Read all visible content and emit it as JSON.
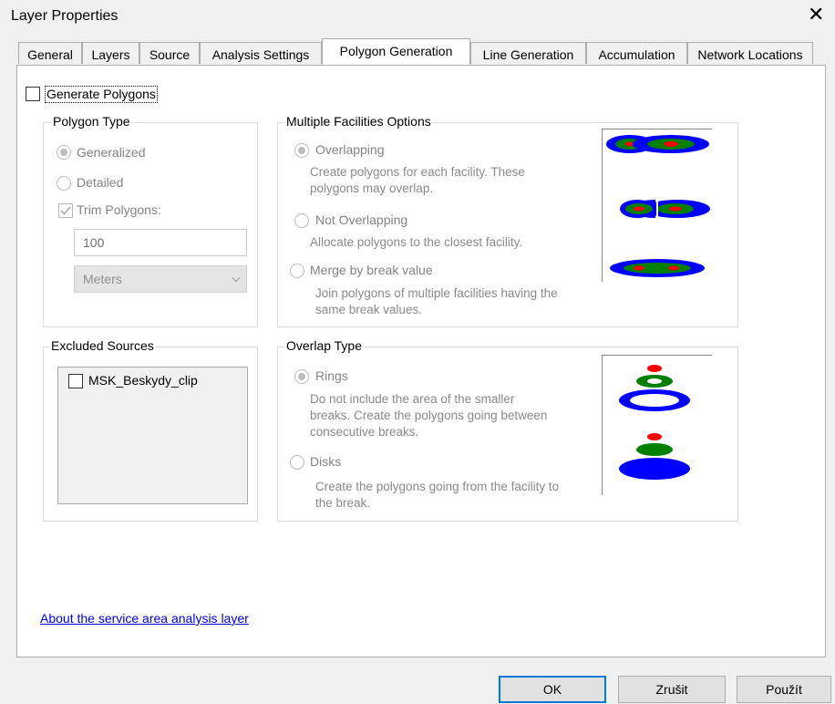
{
  "window": {
    "title": "Layer Properties",
    "close_glyph": "✕"
  },
  "tabs": [
    {
      "label": "General"
    },
    {
      "label": "Layers"
    },
    {
      "label": "Source"
    },
    {
      "label": "Analysis Settings"
    },
    {
      "label": "Polygon Generation",
      "active": true
    },
    {
      "label": "Line Generation"
    },
    {
      "label": "Accumulation"
    },
    {
      "label": "Network Locations"
    }
  ],
  "generate_polygons": {
    "label": "Generate Polygons",
    "checked": false
  },
  "polygon_type": {
    "title": "Polygon Type",
    "generalized": "Generalized",
    "detailed": "Detailed",
    "trim_polygons": "Trim Polygons:",
    "trim_value": "100",
    "units_selected": "Meters"
  },
  "multiple_facilities": {
    "title": "Multiple Facilities Options",
    "overlapping": "Overlapping",
    "overlapping_desc": [
      "Create polygons for each facility. These",
      "polygons may overlap."
    ],
    "not_overlapping": "Not Overlapping",
    "not_overlapping_desc": [
      "Allocate polygons to the closest facility."
    ],
    "merge": "Merge by break value",
    "merge_desc": [
      "Join polygons of multiple facilities having the",
      "same break values."
    ]
  },
  "excluded_sources": {
    "title": "Excluded Sources",
    "items": [
      {
        "label": "MSK_Beskydy_clip",
        "checked": false
      }
    ]
  },
  "overlap_type": {
    "title": "Overlap Type",
    "rings": "Rings",
    "rings_desc": [
      "Do not include the area of the smaller",
      "breaks. Create the polygons going between",
      "consecutive breaks."
    ],
    "disks": "Disks",
    "disks_desc": [
      "Create the polygons going from the facility to",
      "the break."
    ]
  },
  "about_link": "About the service area analysis layer",
  "buttons": {
    "ok": "OK",
    "cancel": "Zrušit",
    "apply": "Použít"
  },
  "colors": {
    "outer_ring": "#0000ff",
    "middle_ring": "#008000",
    "inner": "#ff0000",
    "accent": "#0078d7"
  }
}
